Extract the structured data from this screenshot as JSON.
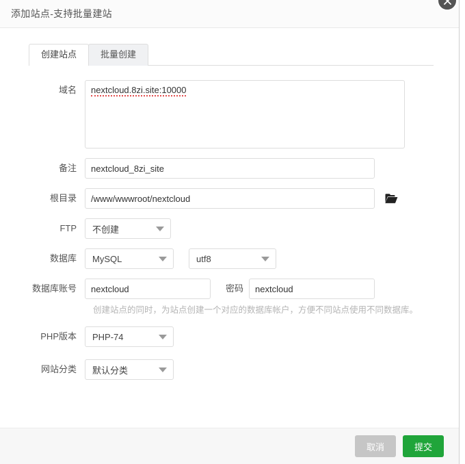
{
  "dialog": {
    "title": "添加站点-支持批量建站",
    "close_icon": "close-icon"
  },
  "tabs": [
    {
      "label": "创建站点",
      "active": true
    },
    {
      "label": "批量创建",
      "active": false
    }
  ],
  "form": {
    "domain": {
      "label": "域名",
      "value": "nextcloud.8zi.site:10000"
    },
    "remark": {
      "label": "备注",
      "value": "nextcloud_8zi_site"
    },
    "root_dir": {
      "label": "根目录",
      "value": "/www/wwwroot/nextcloud",
      "browse_icon": "folder-open-icon"
    },
    "ftp": {
      "label": "FTP",
      "value": "不创建"
    },
    "database": {
      "label": "数据库",
      "value": "MySQL",
      "charset_value": "utf8"
    },
    "db_account": {
      "label": "数据库账号",
      "value": "nextcloud",
      "password_label": "密码",
      "password_value": "nextcloud",
      "hint": "创建站点的同时，为站点创建一个对应的数据库帐户，方便不同站点使用不同数据库。"
    },
    "php_version": {
      "label": "PHP版本",
      "value": "PHP-74"
    },
    "site_category": {
      "label": "网站分类",
      "value": "默认分类"
    }
  },
  "footer": {
    "cancel_label": "取消",
    "submit_label": "提交"
  },
  "colors": {
    "submit_green": "#20a53a",
    "cancel_gray": "#c6c6c6",
    "spellcheck_red": "#e24a4a"
  }
}
